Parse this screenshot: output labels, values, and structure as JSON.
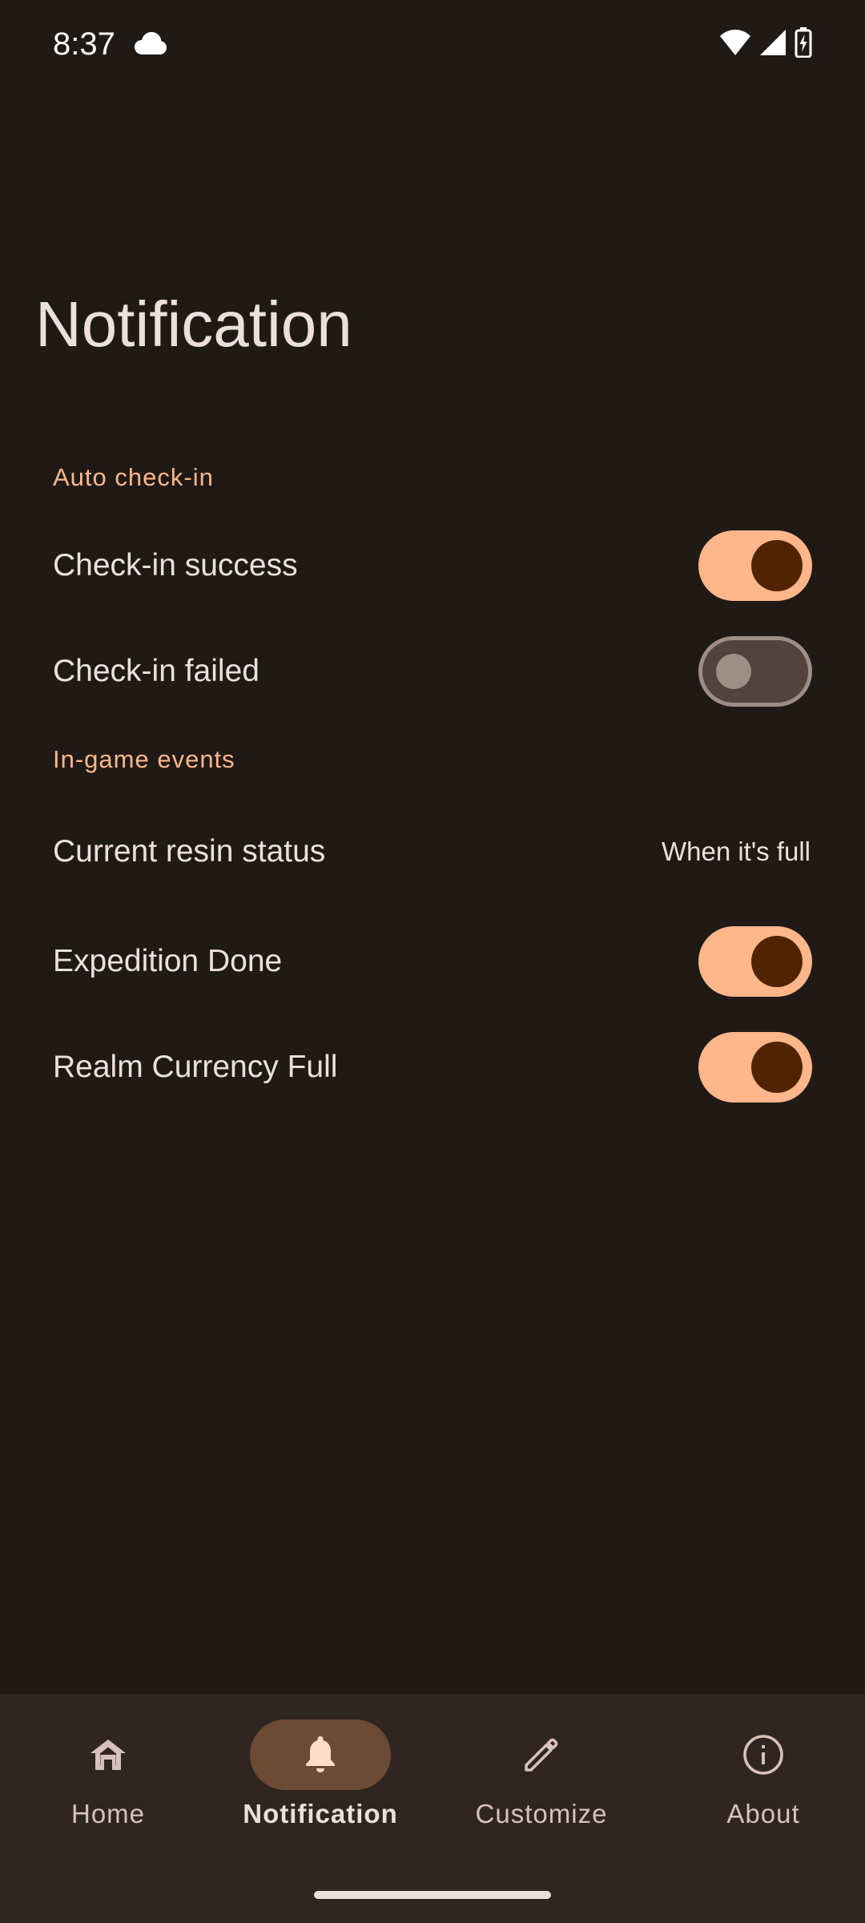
{
  "status_bar": {
    "time": "8:37",
    "icons": [
      "cloud-icon",
      "wifi-icon",
      "signal-icon",
      "battery-charging-icon"
    ]
  },
  "page": {
    "title": "Notification"
  },
  "sections": {
    "auto_checkin": {
      "header": "Auto check-in",
      "rows": [
        {
          "label": "Check-in success",
          "on": true
        },
        {
          "label": "Check-in failed",
          "on": false
        }
      ]
    },
    "in_game_events": {
      "header": "In-game events",
      "resin": {
        "label": "Current resin status",
        "value": "When it's full"
      },
      "rows": [
        {
          "label": "Expedition Done",
          "on": true
        },
        {
          "label": "Realm Currency Full",
          "on": true
        }
      ]
    }
  },
  "bottom_nav": {
    "items": [
      {
        "label": "Home",
        "icon": "home-icon",
        "active": false
      },
      {
        "label": "Notification",
        "icon": "bell-icon",
        "active": true
      },
      {
        "label": "Customize",
        "icon": "pencil-icon",
        "active": false
      },
      {
        "label": "About",
        "icon": "info-icon",
        "active": false
      }
    ]
  },
  "colors": {
    "background": "#201a17",
    "accent": "#ffb68a",
    "switch_thumb_on": "#522300",
    "nav_background": "#2f2521",
    "nav_active_pill": "#6b4a36"
  }
}
